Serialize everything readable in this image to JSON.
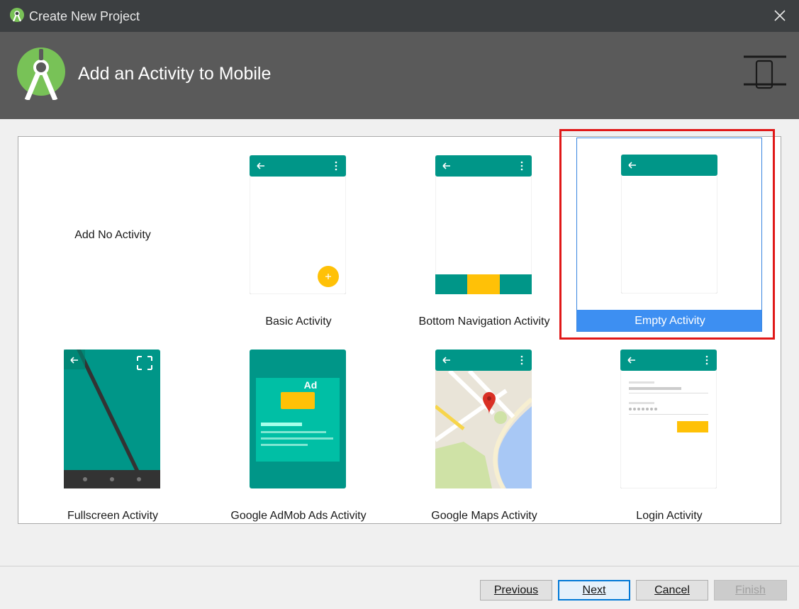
{
  "window": {
    "title": "Create New Project"
  },
  "header": {
    "heading": "Add an Activity to Mobile"
  },
  "activities": [
    {
      "label": "Add No Activity"
    },
    {
      "label": "Basic Activity"
    },
    {
      "label": "Bottom Navigation Activity"
    },
    {
      "label": "Empty Activity",
      "selected": true
    },
    {
      "label": "Fullscreen Activity"
    },
    {
      "label": "Google AdMob Ads Activity",
      "badge": "Ad"
    },
    {
      "label": "Google Maps Activity"
    },
    {
      "label": "Login Activity"
    }
  ],
  "buttons": {
    "previous": "Previous",
    "next": "Next",
    "cancel": "Cancel",
    "finish": "Finish"
  },
  "colors": {
    "teal": "#009688",
    "accent": "#ffc107",
    "selection": "#3d8ff2",
    "highlight": "#e01818"
  }
}
